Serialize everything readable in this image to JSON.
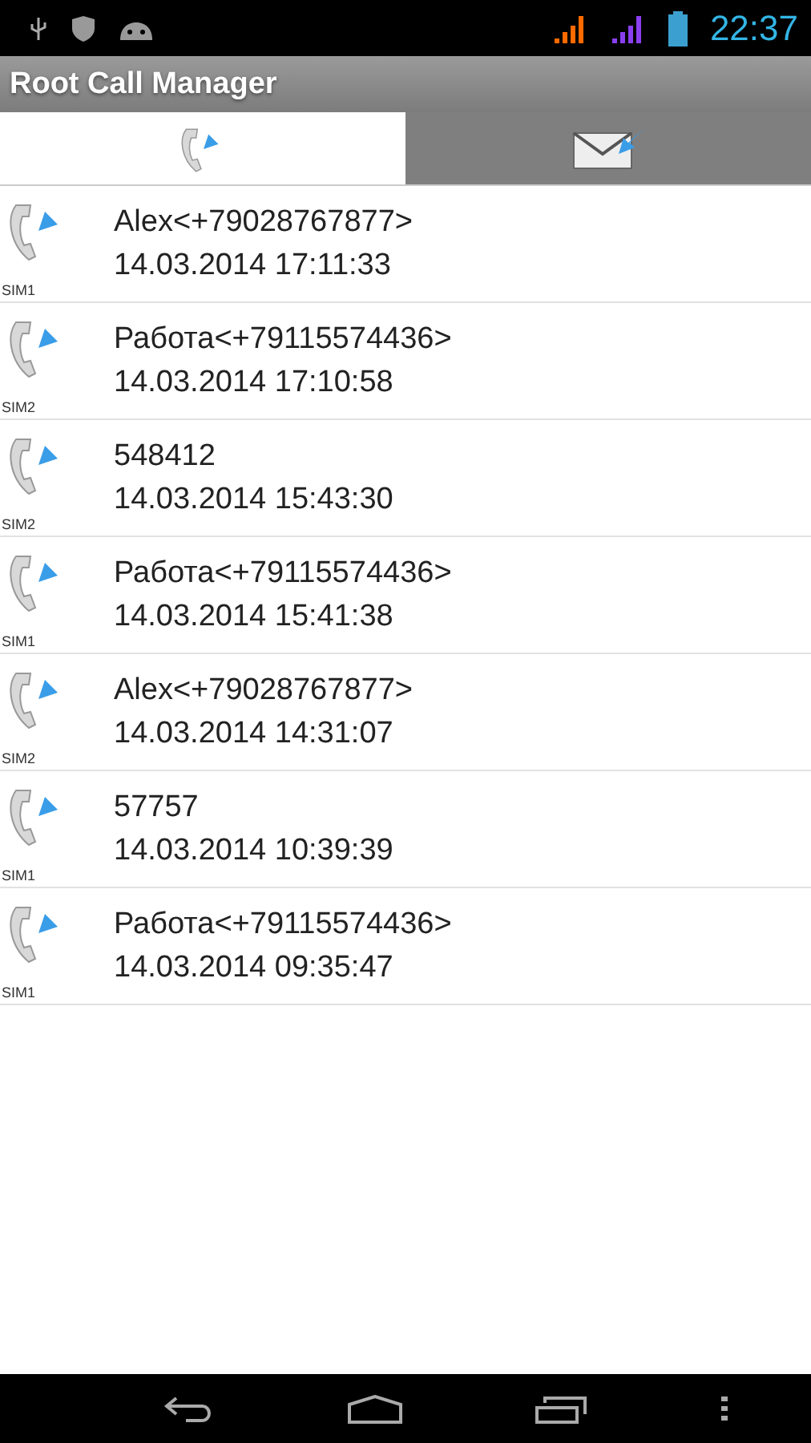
{
  "status_bar": {
    "time": "22:37"
  },
  "app_bar": {
    "title": "Root Call Manager"
  },
  "tabs": [
    {
      "kind": "calls",
      "selected": true
    },
    {
      "kind": "messages",
      "selected": false
    }
  ],
  "calls": [
    {
      "sim": "SIM1",
      "contact": "Alex<+79028767877>",
      "datetime": "14.03.2014 17:11:33"
    },
    {
      "sim": "SIM2",
      "contact": "Работа<+79115574436>",
      "datetime": "14.03.2014 17:10:58"
    },
    {
      "sim": "SIM2",
      "contact": "548412",
      "datetime": "14.03.2014 15:43:30"
    },
    {
      "sim": "SIM1",
      "contact": "Работа<+79115574436>",
      "datetime": "14.03.2014 15:41:38"
    },
    {
      "sim": "SIM2",
      "contact": "Alex<+79028767877>",
      "datetime": "14.03.2014 14:31:07"
    },
    {
      "sim": "SIM1",
      "contact": "57757",
      "datetime": "14.03.2014 10:39:39"
    },
    {
      "sim": "SIM1",
      "contact": "Работа<+79115574436>",
      "datetime": "14.03.2014 09:35:47"
    }
  ]
}
